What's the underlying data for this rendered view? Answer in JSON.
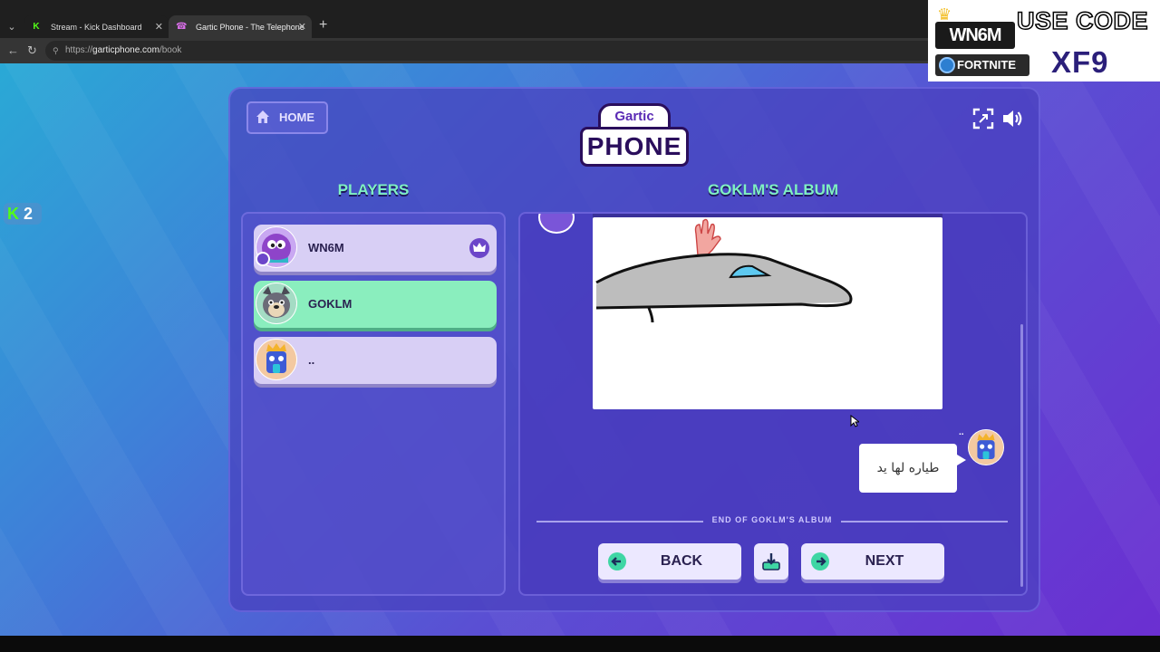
{
  "browser": {
    "tabs": [
      {
        "title": "Stream - Kick Dashboard",
        "favicon": "kick-icon"
      },
      {
        "title": "Gartic Phone - The Telephone Gam",
        "favicon": "gartic-phone-icon"
      }
    ],
    "url_scheme": "https://",
    "url_host": "garticphone.com",
    "url_path": "/book"
  },
  "overlay": {
    "logo_text": "WN6M",
    "use_code_label": "USE CODE",
    "games_label": "FORTNITE",
    "code": "XF9"
  },
  "stream": {
    "viewer_count": "2"
  },
  "game": {
    "home_label": "HOME",
    "logo_top": "Gartic",
    "logo_bottom": "PHONE",
    "players_title": "PLAYERS",
    "album_title": "GOKLM'S ALBUM",
    "players": [
      {
        "name": "WN6M",
        "is_host": true,
        "avatar": "purple-bird-avatar",
        "active": false
      },
      {
        "name": "GOKLM",
        "is_host": false,
        "avatar": "dog-avatar",
        "active": true
      },
      {
        "name": "..",
        "is_host": false,
        "avatar": "king-avatar",
        "active": false
      }
    ],
    "guess_dots": "..",
    "guess_text": "طياره لها يد",
    "end_label": "END OF GOKLM'S ALBUM",
    "back_label": "BACK",
    "next_label": "NEXT",
    "colors": {
      "accent_green": "#7ff0c2",
      "active_player": "#8aeebe",
      "inactive_player": "#d8cff5",
      "panel": "#4840be"
    }
  }
}
